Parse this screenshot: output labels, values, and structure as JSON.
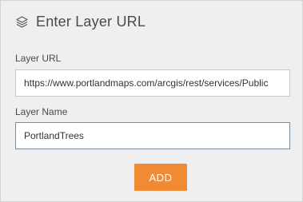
{
  "header": {
    "title": "Enter Layer URL",
    "icon": "layers-icon"
  },
  "form": {
    "url_label": "Layer URL",
    "url_value": "https://www.portlandmaps.com/arcgis/rest/services/Public",
    "name_label": "Layer Name",
    "name_value": "PortlandTrees",
    "add_label": "ADD"
  },
  "colors": {
    "panel_bg": "#efefef",
    "accent": "#f08a33",
    "text": "#4a4a4a"
  }
}
